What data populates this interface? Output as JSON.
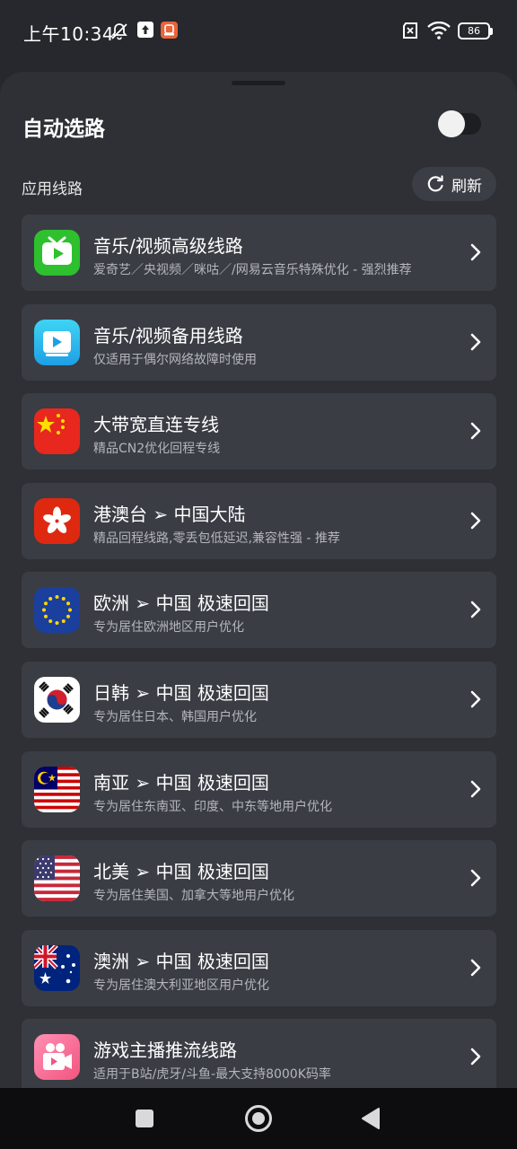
{
  "status_bar": {
    "time": "上午10:34",
    "battery": "86",
    "icons": [
      "mute-bell-icon",
      "upload-icon",
      "app-notification-icon",
      "no-sim-icon",
      "wifi-icon",
      "battery-icon"
    ]
  },
  "header": {
    "title": "自动选路",
    "toggle_on": false
  },
  "section": {
    "label": "应用线路",
    "refresh_label": "刷新"
  },
  "routes": [
    {
      "title": "音乐/视频高级线路",
      "subtitle": "爱奇艺／央视频／咪咕／/网易云音乐特殊优化 - 强烈推荐",
      "icon": "tv-play-icon"
    },
    {
      "title": "音乐/视频备用线路",
      "subtitle": "仅适用于偶尔网络故障时使用",
      "icon": "video-play-icon"
    },
    {
      "title": "大带宽直连专线",
      "subtitle": "精品CN2优化回程专线",
      "icon": "china-flag-icon"
    },
    {
      "title": "港澳台 ➢ 中国大陆",
      "subtitle": "精品回程线路,零丢包低延迟,兼容性强 - 推荐",
      "icon": "hong-kong-flag-icon"
    },
    {
      "title": "欧洲 ➢ 中国 极速回国",
      "subtitle": "专为居住欧洲地区用户优化",
      "icon": "eu-flag-icon"
    },
    {
      "title": "日韩 ➢ 中国 极速回国",
      "subtitle": "专为居住日本、韩国用户优化",
      "icon": "korea-flag-icon"
    },
    {
      "title": "南亚 ➢ 中国 极速回国",
      "subtitle": "专为居住东南亚、印度、中东等地用户优化",
      "icon": "malaysia-flag-icon"
    },
    {
      "title": "北美 ➢ 中国 极速回国",
      "subtitle": "专为居住美国、加拿大等地用户优化",
      "icon": "usa-flag-icon"
    },
    {
      "title": "澳洲 ➢ 中国 极速回国",
      "subtitle": "专为居住澳大利亚地区用户优化",
      "icon": "australia-flag-icon"
    },
    {
      "title": "游戏主播推流线路",
      "subtitle": "适用于B站/虎牙/斗鱼-最大支持8000K码率",
      "icon": "video-camera-icon"
    }
  ],
  "colors": {
    "background": "#26282d",
    "sheet": "#2e3036",
    "card": "#3a3d44",
    "subtitle": "#b4b6bb"
  }
}
